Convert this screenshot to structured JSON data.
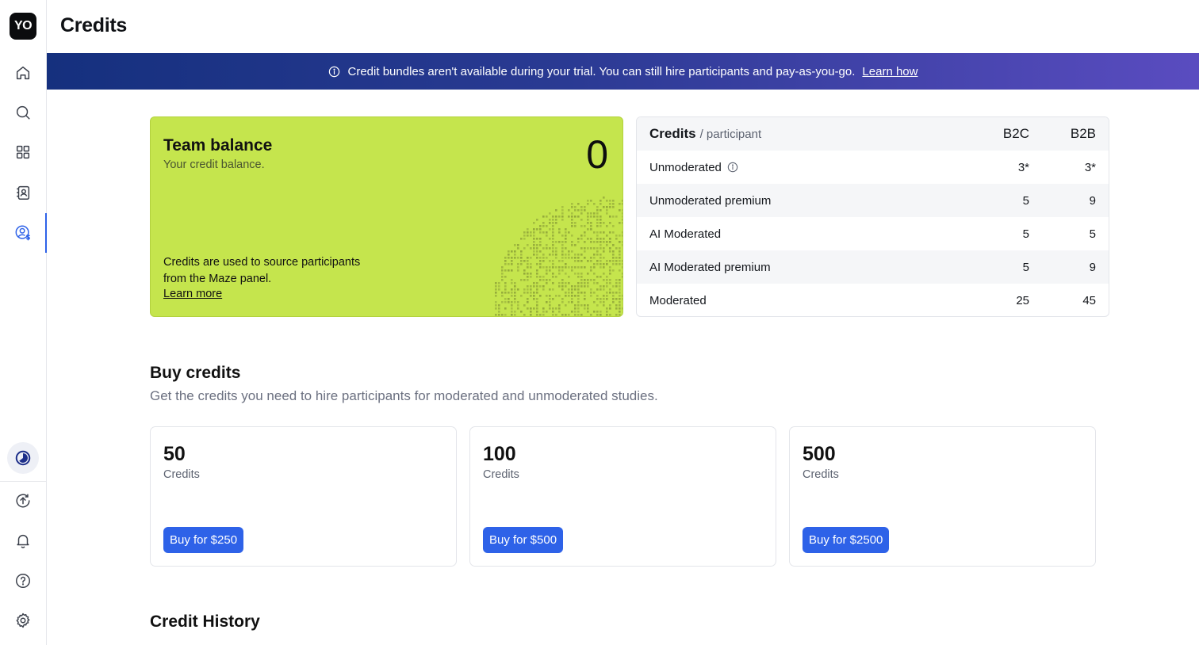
{
  "app": {
    "logo_text": "YO"
  },
  "sidebar": {
    "items": [
      {
        "name": "home",
        "icon": "home-icon"
      },
      {
        "name": "search",
        "icon": "search-icon"
      },
      {
        "name": "dashboard",
        "icon": "grid-icon"
      },
      {
        "name": "panel",
        "icon": "contacts-icon"
      },
      {
        "name": "credits",
        "icon": "user-dollar-icon",
        "active": true
      }
    ],
    "bottom_items": [
      {
        "name": "usage",
        "icon": "pie-chart-icon"
      },
      {
        "name": "upgrade",
        "icon": "upload-circle-icon"
      },
      {
        "name": "notifications",
        "icon": "bell-icon"
      },
      {
        "name": "help",
        "icon": "question-icon"
      },
      {
        "name": "settings",
        "icon": "gear-icon"
      }
    ]
  },
  "header": {
    "title": "Credits"
  },
  "banner": {
    "text": "Credit bundles aren't available during your trial. You can still hire participants and pay-as-you-go.",
    "link": "Learn how"
  },
  "balance": {
    "title": "Team balance",
    "subtitle": "Your credit balance.",
    "value": "0",
    "description": "Credits are used to source participants from the Maze panel.",
    "link": "Learn more",
    "accent": "#c5e54d"
  },
  "credits_table": {
    "title": "Credits",
    "per": "/ participant",
    "columns": [
      "B2C",
      "B2B"
    ],
    "rows": [
      {
        "name": "Unmoderated",
        "b2c": "3*",
        "b2b": "3*",
        "info": true
      },
      {
        "name": "Unmoderated premium",
        "b2c": "5",
        "b2b": "9"
      },
      {
        "name": "AI Moderated",
        "b2c": "5",
        "b2b": "5"
      },
      {
        "name": "AI Moderated premium",
        "b2c": "5",
        "b2b": "9"
      },
      {
        "name": "Moderated",
        "b2c": "25",
        "b2b": "45"
      }
    ]
  },
  "buy": {
    "title": "Buy credits",
    "subtitle": "Get the credits you need to hire participants for moderated and unmoderated studies.",
    "bundles": [
      {
        "amount": "50",
        "unit": "Credits",
        "button": "Buy for $250"
      },
      {
        "amount": "100",
        "unit": "Credits",
        "button": "Buy for $500"
      },
      {
        "amount": "500",
        "unit": "Credits",
        "button": "Buy for $2500"
      }
    ]
  },
  "history": {
    "title": "Credit History"
  },
  "colors": {
    "primary": "#2e62e8",
    "banner_start": "#15307e",
    "banner_end": "#5a4cc0"
  }
}
